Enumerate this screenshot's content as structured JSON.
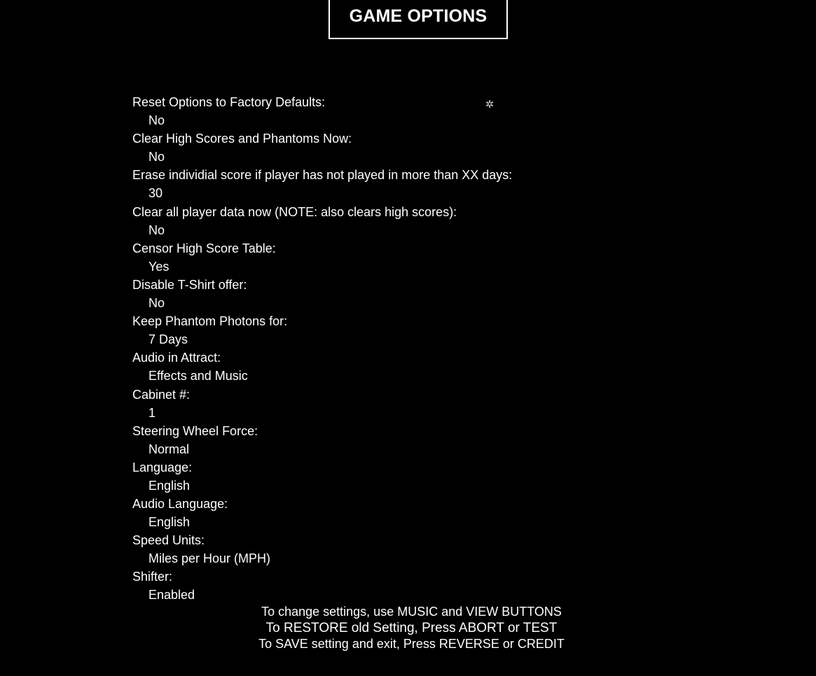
{
  "header": {
    "title": "GAME OPTIONS"
  },
  "cursor_icon": "sparkle-icon",
  "options": [
    {
      "label": "Reset Options to Factory Defaults:",
      "value": "No"
    },
    {
      "label": "Clear High Scores and Phantoms Now:",
      "value": "No"
    },
    {
      "label": "Erase individial score if player has not played in more than XX days:",
      "value": "30"
    },
    {
      "label": "Clear all player data now (NOTE: also clears high scores):",
      "value": "No"
    },
    {
      "label": "Censor High Score Table:",
      "value": "Yes"
    },
    {
      "label": "Disable T-Shirt offer:",
      "value": "No"
    },
    {
      "label": "Keep Phantom Photons for:",
      "value": "7 Days"
    },
    {
      "label": "Audio in Attract:",
      "value": "Effects and Music"
    },
    {
      "label": "Cabinet #:",
      "value": "1"
    },
    {
      "label": "Steering Wheel Force:",
      "value": "Normal"
    },
    {
      "label": "Language:",
      "value": "English"
    },
    {
      "label": "Audio Language:",
      "value": "English"
    },
    {
      "label": "Speed Units:",
      "value": "Miles per Hour (MPH)"
    },
    {
      "label": "Shifter:",
      "value": "Enabled"
    }
  ],
  "footer": {
    "line1": "To change settings, use MUSIC and VIEW BUTTONS",
    "line2": "To RESTORE old Setting, Press ABORT or TEST",
    "line3": "To SAVE setting and exit, Press REVERSE or CREDIT"
  },
  "colors": {
    "background": "#000000",
    "text": "#ffffff"
  }
}
